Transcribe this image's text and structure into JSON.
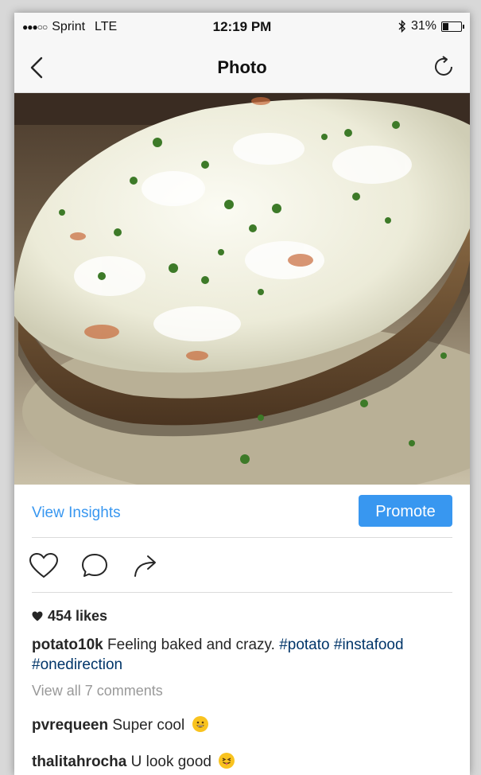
{
  "status_bar": {
    "signal": "●●●○○",
    "carrier": "Sprint",
    "network": "LTE",
    "time": "12:19 PM",
    "battery": "31%",
    "battery_level": 0.31
  },
  "nav": {
    "title": "Photo",
    "back_icon": "chevron-left-icon",
    "refresh_icon": "refresh-icon"
  },
  "insights": {
    "view_insights_label": "View Insights",
    "promote_label": "Promote"
  },
  "action_icons": [
    "heart-icon",
    "comment-icon",
    "share-icon"
  ],
  "post": {
    "likes": "454 likes",
    "caption_user": "potato10k",
    "caption_text": " Feeling baked and crazy. ",
    "hashtags": [
      "#potato",
      "#instafood",
      "#onedirection"
    ],
    "view_all_comments": "View all 7 comments"
  },
  "comments": [
    {
      "user": "pvrequeen",
      "text": " Super cool "
    },
    {
      "user": "thalitahrocha",
      "text": " U look good "
    }
  ],
  "colors": {
    "accent": "#3897f0",
    "hashtag": "#003569",
    "muted": "#999999"
  }
}
